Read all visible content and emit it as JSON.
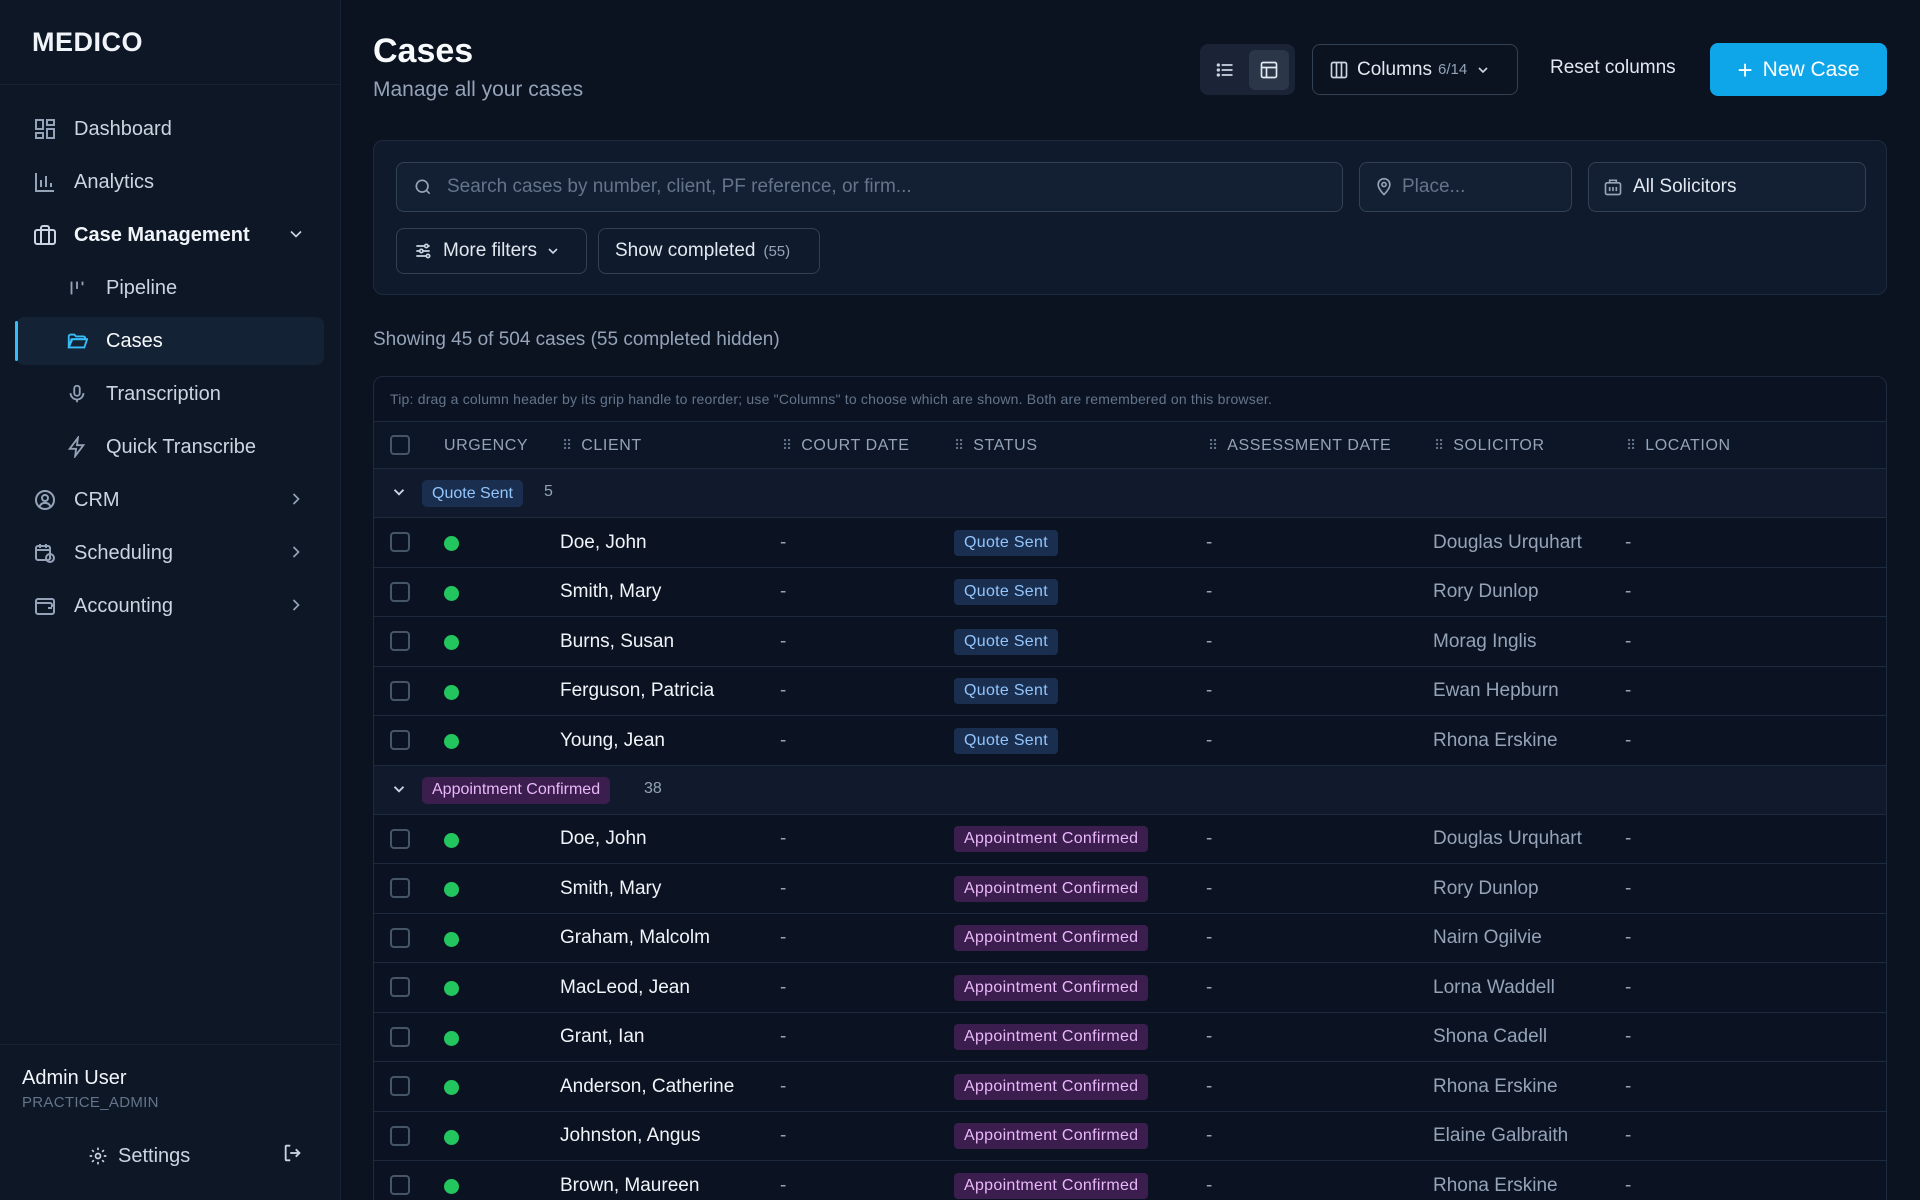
{
  "app": {
    "brand": "MEDICO"
  },
  "sidebar": {
    "items": [
      {
        "label": "Dashboard",
        "icon": "dashboard-icon"
      },
      {
        "label": "Analytics",
        "icon": "bar-chart-icon"
      },
      {
        "label": "Case Management",
        "icon": "briefcase-icon"
      },
      {
        "label": "Pipeline",
        "icon": "pipeline-icon"
      },
      {
        "label": "Cases",
        "icon": "folder-open-icon"
      },
      {
        "label": "Transcription",
        "icon": "microphone-icon"
      },
      {
        "label": "Quick Transcribe",
        "icon": "lightning-icon"
      },
      {
        "label": "CRM",
        "icon": "user-circle-icon"
      },
      {
        "label": "Scheduling",
        "icon": "calendar-clock-icon"
      },
      {
        "label": "Accounting",
        "icon": "wallet-icon"
      }
    ],
    "active": "Cases",
    "user": {
      "name": "Admin User",
      "role": "PRACTICE_ADMIN"
    },
    "settings_label": "Settings"
  },
  "header": {
    "title": "Cases",
    "subtitle": "Manage all your cases",
    "columns_label": "Columns",
    "columns_count": "6/14",
    "reset_label": "Reset columns",
    "new_case_label": "New Case"
  },
  "filters": {
    "search_placeholder": "Search cases by number, client, PF reference, or firm...",
    "place_placeholder": "Place...",
    "solicitor_value": "All Solicitors",
    "more_filters_label": "More filters",
    "show_completed_label": "Show completed",
    "show_completed_count": "(55)"
  },
  "summary": "Showing 45 of 504 cases (55 completed hidden)",
  "table": {
    "tip": "Tip: drag a column header by its grip handle to reorder; use \"Columns\" to choose which are shown. Both are remembered on this browser.",
    "headers": [
      "URGENCY",
      "CLIENT",
      "COURT DATE",
      "STATUS",
      "ASSESSMENT DATE",
      "SOLICITOR",
      "LOCATION"
    ],
    "groups": [
      {
        "name": "Quote Sent",
        "count": "5",
        "color": "#93c5fd",
        "rows": [
          {
            "client": "Doe, John",
            "court": "-",
            "status": "Quote Sent",
            "assess": "-",
            "solicitor": "Douglas Urquhart",
            "location": "-"
          },
          {
            "client": "Smith, Mary",
            "court": "-",
            "status": "Quote Sent",
            "assess": "-",
            "solicitor": "Rory Dunlop",
            "location": "-"
          },
          {
            "client": "Burns, Susan",
            "court": "-",
            "status": "Quote Sent",
            "assess": "-",
            "solicitor": "Morag Inglis",
            "location": "-"
          },
          {
            "client": "Ferguson, Patricia",
            "court": "-",
            "status": "Quote Sent",
            "assess": "-",
            "solicitor": "Ewan Hepburn",
            "location": "-"
          },
          {
            "client": "Young, Jean",
            "court": "-",
            "status": "Quote Sent",
            "assess": "-",
            "solicitor": "Rhona Erskine",
            "location": "-"
          }
        ]
      },
      {
        "name": "Appointment Confirmed",
        "count": "38",
        "color": "#e9b8fb",
        "rows": [
          {
            "client": "Doe, John",
            "court": "-",
            "status": "Appointment Confirmed",
            "assess": "-",
            "solicitor": "Douglas Urquhart",
            "location": "-"
          },
          {
            "client": "Smith, Mary",
            "court": "-",
            "status": "Appointment Confirmed",
            "assess": "-",
            "solicitor": "Rory Dunlop",
            "location": "-"
          },
          {
            "client": "Graham, Malcolm",
            "court": "-",
            "status": "Appointment Confirmed",
            "assess": "-",
            "solicitor": "Nairn Ogilvie",
            "location": "-"
          },
          {
            "client": "MacLeod, Jean",
            "court": "-",
            "status": "Appointment Confirmed",
            "assess": "-",
            "solicitor": "Lorna Waddell",
            "location": "-"
          },
          {
            "client": "Grant, Ian",
            "court": "-",
            "status": "Appointment Confirmed",
            "assess": "-",
            "solicitor": "Shona Cadell",
            "location": "-"
          },
          {
            "client": "Anderson, Catherine",
            "court": "-",
            "status": "Appointment Confirmed",
            "assess": "-",
            "solicitor": "Rhona Erskine",
            "location": "-"
          },
          {
            "client": "Johnston, Angus",
            "court": "-",
            "status": "Appointment Confirmed",
            "assess": "-",
            "solicitor": "Elaine Galbraith",
            "location": "-"
          },
          {
            "client": "Brown, Maureen",
            "court": "-",
            "status": "Appointment Confirmed",
            "assess": "-",
            "solicitor": "Rhona Erskine",
            "location": "-"
          }
        ]
      }
    ]
  }
}
